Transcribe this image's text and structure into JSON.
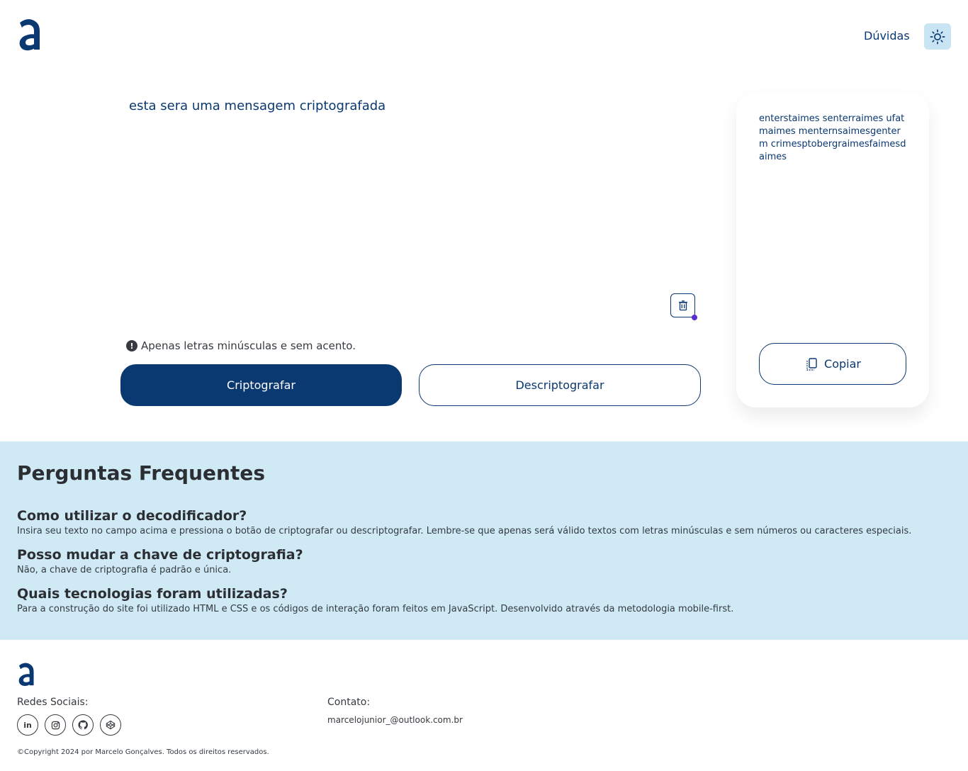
{
  "header": {
    "nav_help": "Dúvidas",
    "theme_icon": "sun-icon",
    "accent": "#0a3871",
    "theme_bg": "#c9e5f3"
  },
  "editor": {
    "input_value": "esta sera uma mensagem criptografada",
    "hint": "Apenas letras minúsculas e sem acento.",
    "encrypt_label": "Criptografar",
    "decrypt_label": "Descriptografar"
  },
  "result": {
    "output_text": "enterstaimes senterraimes ufatmaimes menternsaimesgenterm crimesptobergraimesfaimesdaimes",
    "copy_label": "Copiar"
  },
  "faq": {
    "title": "Perguntas Frequentes",
    "items": [
      {
        "question": "Como utilizar o decodificador?",
        "answer": "Insira seu texto no campo acima e pressiona o botão de criptografar ou descriptografar. Lembre-se que apenas será válido textos com letras minúsculas e sem números ou caracteres especiais."
      },
      {
        "question": "Posso mudar a chave de criptografia?",
        "answer": "Não, a chave de criptografia é padrão e única."
      },
      {
        "question": "Quais tecnologias foram utilizadas?",
        "answer": "Para a construção do site foi utilizado HTML e CSS e os códigos de interação foram feitos em JavaScript. Desenvolvido através da metodologia mobile-first."
      }
    ],
    "background": "#cfeaf5"
  },
  "footer": {
    "social_label": "Redes Sociais:",
    "socials": [
      "linkedin-icon",
      "instagram-icon",
      "github-icon",
      "codepen-icon"
    ],
    "contact_label": "Contato:",
    "contact_email": "marcelojunior_@outlook.com.br",
    "copyright": "©Copyright 2024 por Marcelo Gonçalves. Todos os direitos reservados."
  }
}
